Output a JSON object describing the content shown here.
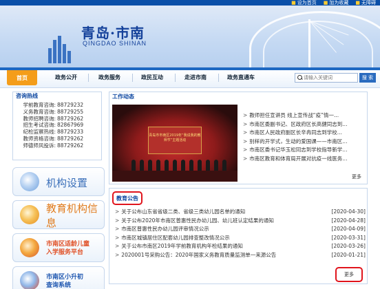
{
  "toplinks": [
    "设为首页",
    "加为收藏",
    "无障碍"
  ],
  "banner": {
    "title": "青岛·市南",
    "subtitle": "QINGDAO SHINAN"
  },
  "nav": {
    "home": "首页",
    "items": [
      "政务公开",
      "政务服务",
      "政民互动",
      "走进市南",
      "政务直通车"
    ],
    "search_placeholder": "请输入关键词",
    "search_button": "搜 索"
  },
  "hotline": {
    "title": "咨询热线",
    "rows": [
      {
        "k": "学前教育咨询:",
        "v": "88729232"
      },
      {
        "k": "义务教育咨询:",
        "v": "88729255"
      },
      {
        "k": "教师招聘咨询:",
        "v": "88729262"
      },
      {
        "k": "招生考试咨询:",
        "v": "82867969"
      },
      {
        "k": "纪检监察热线:",
        "v": "88729233"
      },
      {
        "k": "教师资格咨询:",
        "v": "88729262"
      },
      {
        "k": "师德师风投诉:",
        "v": "88729262"
      }
    ]
  },
  "side_cards": {
    "c1": "机构设置",
    "c2": "教育机构信息",
    "c3": [
      "市南区适龄儿童",
      "入学服务平台"
    ],
    "c4": [
      "市南区小升初",
      "查询系统"
    ]
  },
  "work": {
    "title": "工作动态",
    "photo_caption": "青岛市市南区2019年“我说我的教师节”主题活动",
    "items": [
      "教师担任宣讲员 线上宣传战“疫”情一...",
      "市南区委副书记、区政府区长高健同志到...",
      "市南区人民政府副区长辛冉同志到学校...",
      "别样的开学式，生动的爱国课——市南区...",
      "市南区委书记华玉松同志到学校指导新学...",
      "市南区教育和体育局开展对抗疫一线医务..."
    ],
    "more": "更多"
  },
  "notice": {
    "title": "教育公告",
    "items": [
      {
        "t": "关于公布山东省省级二类、省级三类幼儿园名单的通知",
        "d": "[2020-04-30]"
      },
      {
        "t": "关于公布2020年市南区普惠性民办幼儿园、幼儿班认定结果的通知",
        "d": "[2020-04-28]"
      },
      {
        "t": "市南区普惠性民办幼儿园评审情况公示",
        "d": "[2020-04-09]"
      },
      {
        "t": "市南区城镇居住区配套幼儿园排查整改情况公示",
        "d": "[2020-03-31]"
      },
      {
        "t": "关于公布市南区2019年学前教育机构年检结果的通知",
        "d": "[2020-03-26]"
      },
      {
        "t": "2020001号采购公告：2020年国家义务教育质量监测单一来源公告",
        "d": "[2020-01-21]"
      }
    ],
    "more": "更多"
  }
}
